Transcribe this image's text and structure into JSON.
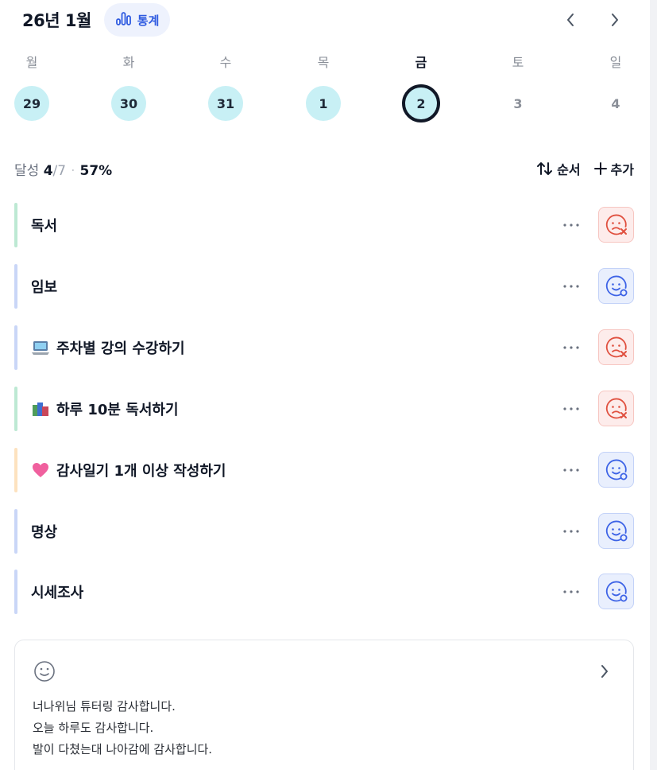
{
  "header": {
    "month_title": "26년 1월",
    "stats_label": "통계"
  },
  "week": [
    {
      "label": "월",
      "date": "29",
      "state": "done"
    },
    {
      "label": "화",
      "date": "30",
      "state": "done"
    },
    {
      "label": "수",
      "date": "31",
      "state": "done"
    },
    {
      "label": "목",
      "date": "1",
      "state": "done"
    },
    {
      "label": "금",
      "date": "2",
      "state": "today"
    },
    {
      "label": "토",
      "date": "3",
      "state": "plain"
    },
    {
      "label": "일",
      "date": "4",
      "state": "plain"
    }
  ],
  "summary": {
    "label": "달성",
    "done": "4",
    "total": "/7",
    "separator": "·",
    "percent": "57%",
    "sort_label": "순서",
    "add_label": "추가"
  },
  "habits": [
    {
      "title": "독서",
      "emoji": "",
      "bar_color": "#bde9d3",
      "status": "fail"
    },
    {
      "title": "임보",
      "emoji": "",
      "bar_color": "#c9d6f7",
      "status": "ok"
    },
    {
      "title": "주차별 강의 수강하기",
      "emoji": "laptop-icon",
      "bar_color": "#c9d6f7",
      "status": "fail"
    },
    {
      "title": "하루 10분 독서하기",
      "emoji": "books-icon",
      "bar_color": "#bde9d3",
      "status": "fail"
    },
    {
      "title": "감사일기 1개 이상 작성하기",
      "emoji": "heart-icon",
      "bar_color": "#fde2bf",
      "status": "ok"
    },
    {
      "title": "명상",
      "emoji": "",
      "bar_color": "#c9d6f7",
      "status": "ok"
    },
    {
      "title": "시세조사",
      "emoji": "",
      "bar_color": "#c9d6f7",
      "status": "ok"
    }
  ],
  "diary": {
    "lines": [
      "너나위님 튜터링 감사합니다.",
      "오늘 하루도 감사합니다.",
      "발이 다쳤는대 나아감에 감사합니다."
    ]
  },
  "colors": {
    "accent": "#2f5be0",
    "done_day": "#c8f0f5",
    "fail": "#e0503f",
    "ok": "#3d63e6"
  }
}
